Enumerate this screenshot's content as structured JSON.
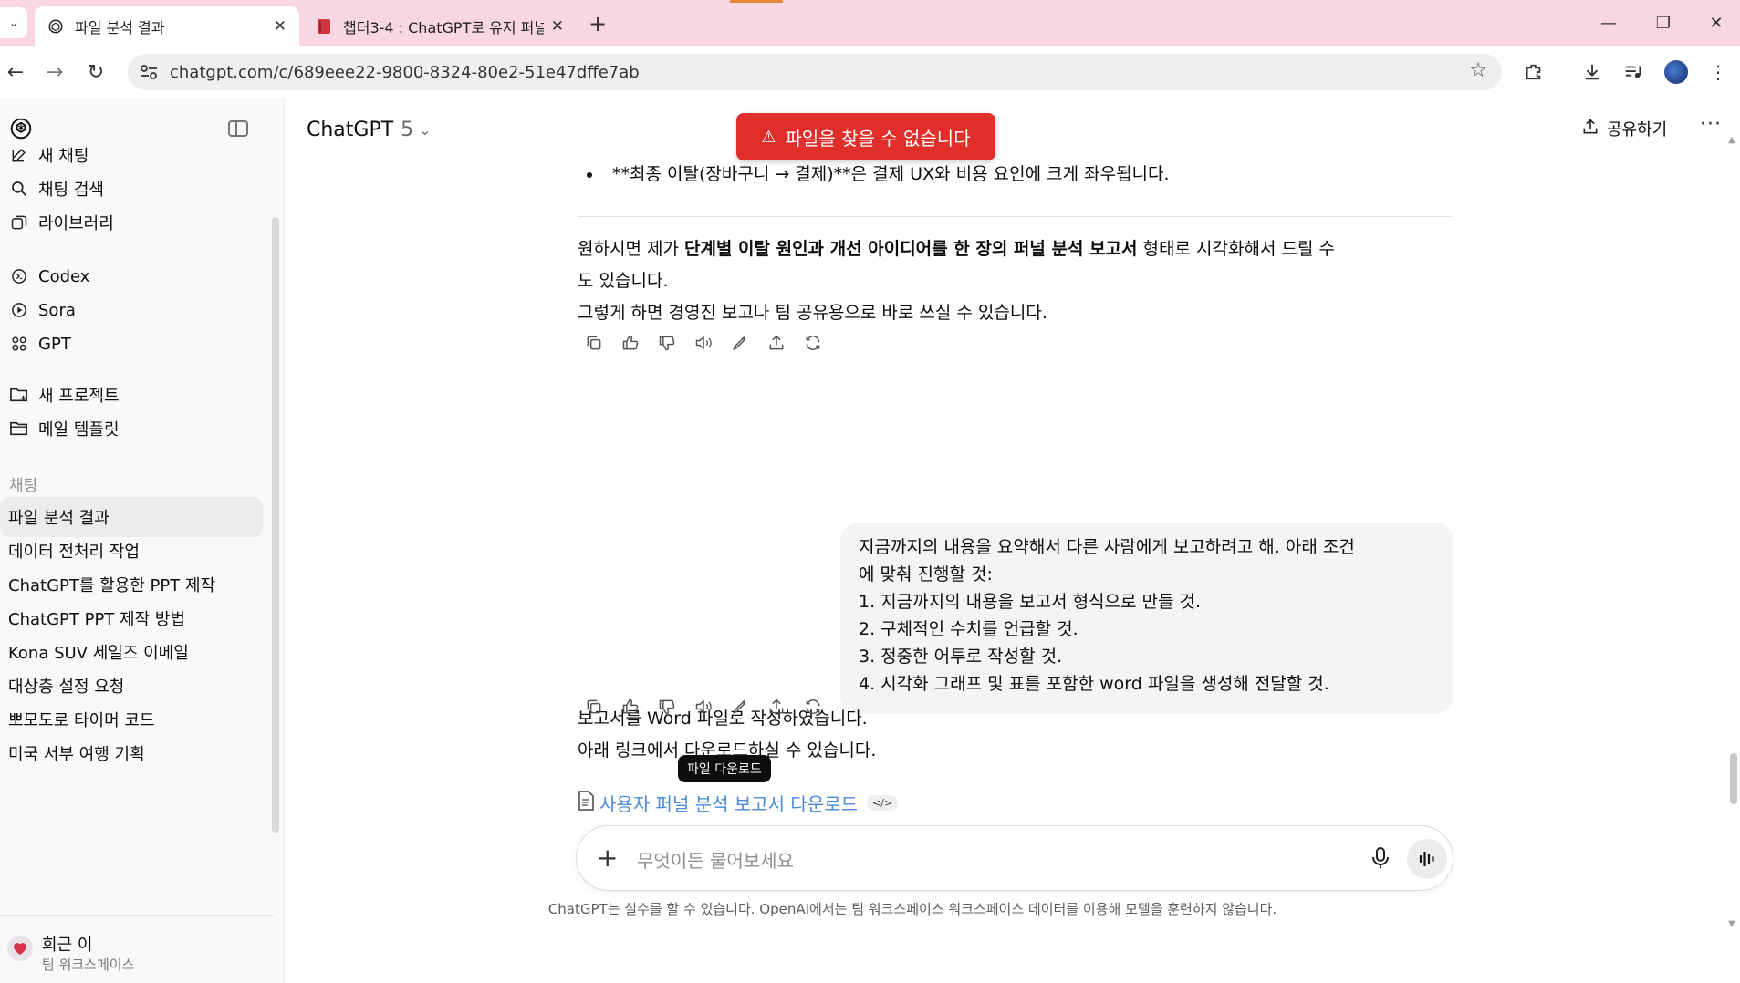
{
  "browser": {
    "tabs": [
      {
        "title": "파일 분석 결과",
        "active": true
      },
      {
        "title": "챕터3-4 : ChatGPT로 유저 퍼널",
        "active": false
      }
    ],
    "url": "chatgpt.com/c/689eee22-9800-8324-80e2-51e47dffe7ab"
  },
  "sidebar": {
    "nav": [
      {
        "label": "새 채팅",
        "icon": "new-chat-icon"
      },
      {
        "label": "채팅 검색",
        "icon": "search-icon"
      },
      {
        "label": "라이브러리",
        "icon": "library-icon"
      }
    ],
    "apps": [
      {
        "label": "Codex",
        "icon": "codex-icon"
      },
      {
        "label": "Sora",
        "icon": "sora-icon"
      },
      {
        "label": "GPT",
        "icon": "gpt-grid-icon"
      }
    ],
    "projects": [
      {
        "label": "새 프로젝트",
        "icon": "new-folder-icon"
      },
      {
        "label": "메일 템플릿",
        "icon": "folder-icon"
      }
    ],
    "section_label": "채팅",
    "chats": [
      "파일 분석 결과",
      "데이터 전처리 작업",
      "ChatGPT를 활용한 PPT 제작",
      "ChatGPT PPT 제작 방법",
      "Kona SUV 세일즈 이메일",
      "대상층 설정 요청",
      "뽀모도로 타이머 코드",
      "미국 서부 여행 기획"
    ],
    "user": {
      "name": "희근 이",
      "workspace": "팀 워크스페이스"
    }
  },
  "header": {
    "model": "ChatGPT",
    "version": "5",
    "share_label": "공유하기"
  },
  "toast": {
    "message": "파일을 찾을 수 없습니다",
    "color": "#e02e2a"
  },
  "conversation": {
    "bullet": "**최종 이탈(장바구니 → 결제)**은 결제 UX와 비용 요인에 크게 좌우됩니다.",
    "ai_reply_1": {
      "line1_prefix": "원하시면 제가 ",
      "line1_bold": "단계별 이탈 원인과 개선 아이디어를 한 장의 퍼널 분석 보고서",
      "line1_suffix": " 형태로 시각화해서 드릴 수",
      "line2": "도 있습니다.",
      "line3": "그렇게 하면 경영진 보고나 팀 공유용으로 바로 쓰실 수 있습니다."
    },
    "user_message": {
      "line1": "지금까지의 내용을 요약해서 다른 사람에게 보고하려고 해. 아래 조건",
      "line2": "에 맞춰 진행할 것:",
      "items": [
        "1. 지금까지의 내용을 보고서 형식으로 만들 것.",
        "2. 구체적인 수치를 언급할 것.",
        "3. 정중한 어투로 작성할 것.",
        "4. 시각화 그래프 및 표를 포함한 word 파일을 생성해 전달할 것."
      ]
    },
    "ai_reply_2": {
      "line1": "보고서를 Word 파일로 작성하였습니다.",
      "line2": "아래 링크에서 다운로드하실 수 있습니다.",
      "link": "사용자 퍼널 분석 보고서 다운로드",
      "code_badge": "</>",
      "tooltip": "파일 다운로드"
    }
  },
  "composer": {
    "placeholder": "무엇이든 물어보세요"
  },
  "footer": "ChatGPT는 실수를 할 수 있습니다. OpenAI에서는 팀 워크스페이스 워크스페이스 데이터를 이용해 모델을 훈련하지 않습니다."
}
